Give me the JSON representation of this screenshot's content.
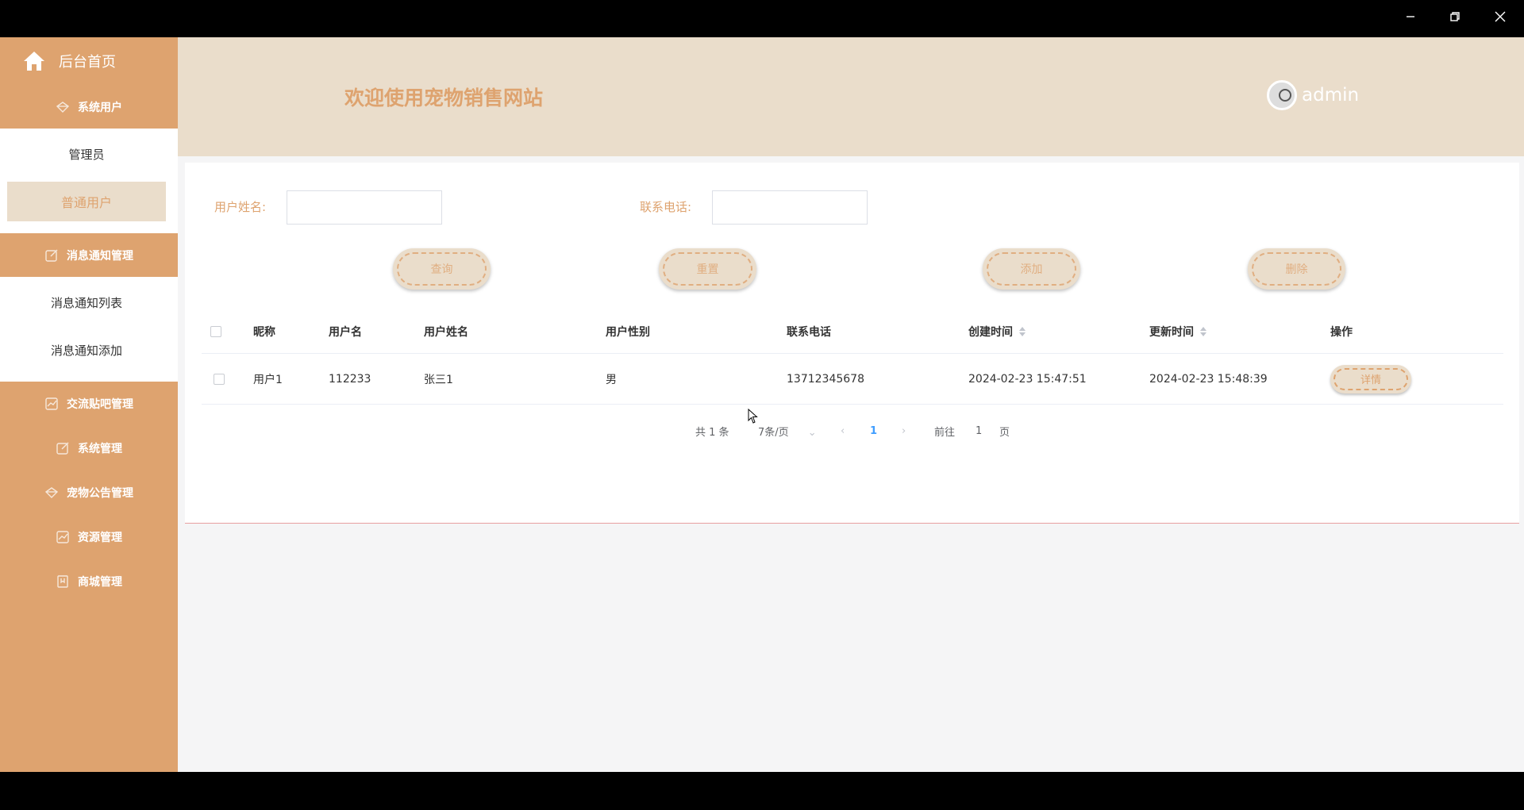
{
  "sidebar": {
    "brand": "后台首页",
    "groups": [
      {
        "title": "系统用户",
        "icon": "diamond-icon",
        "items": [
          "管理员",
          "普通用户"
        ],
        "active": "普通用户"
      },
      {
        "title": "消息通知管理",
        "icon": "edit-icon",
        "items": [
          "消息通知列表",
          "消息通知添加"
        ]
      },
      {
        "title": "交流贴吧管理",
        "icon": "chart-icon",
        "items": []
      },
      {
        "title": "系统管理",
        "icon": "edit-icon",
        "items": []
      },
      {
        "title": "宠物公告管理",
        "icon": "diamond-icon",
        "items": []
      },
      {
        "title": "资源管理",
        "icon": "chart-icon",
        "items": []
      },
      {
        "title": "商城管理",
        "icon": "bookmark-icon",
        "items": []
      }
    ]
  },
  "header": {
    "title": "欢迎使用宠物销售网站",
    "username": "admin"
  },
  "search": {
    "name_label": "用户姓名:",
    "name_value": "",
    "phone_label": "联系电话:",
    "phone_value": ""
  },
  "actions": {
    "query": "查询",
    "reset": "重置",
    "add": "添加",
    "delete": "删除"
  },
  "table": {
    "columns": [
      "昵称",
      "用户名",
      "用户姓名",
      "用户性别",
      "联系电话",
      "创建时间",
      "更新时间",
      "操作"
    ],
    "rows": [
      {
        "nickname": "用户1",
        "username": "112233",
        "realname": "张三1",
        "gender": "男",
        "phone": "13712345678",
        "created": "2024-02-23 15:47:51",
        "updated": "2024-02-23 15:48:39",
        "action": "详情"
      }
    ]
  },
  "pagination": {
    "total": "共 1 条",
    "page_size": "7条/页",
    "current": "1",
    "goto_label": "前往",
    "goto_value": "1",
    "page_suffix": "页"
  },
  "colors": {
    "accent": "#dea36f",
    "header_bg": "#eaddcb"
  }
}
